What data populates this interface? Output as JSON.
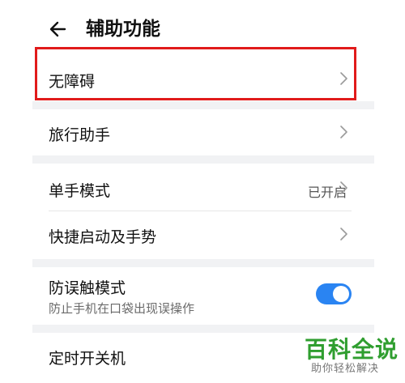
{
  "header": {
    "title": "辅助功能",
    "back_icon": "arrow-left-icon"
  },
  "rows": {
    "accessibility": {
      "label": "无障碍",
      "chevron": "chevron-right-icon"
    },
    "travel": {
      "label": "旅行助手",
      "chevron": "chevron-right-icon"
    },
    "one_hand": {
      "label": "单手模式",
      "value": "已开启",
      "chevron": "chevron-right-icon"
    },
    "shortcut": {
      "label": "快捷启动及手势",
      "chevron": "chevron-right-icon"
    },
    "anti_touch": {
      "label": "防误触模式",
      "subtitle": "防止手机在口袋出现误操作",
      "toggle_on": true
    },
    "timer_power": {
      "label": "定时开关机"
    }
  },
  "colors": {
    "accent": "#2a84f2",
    "highlight": "#e11b1b",
    "watermark": "#2f9e2f"
  },
  "watermark": {
    "main": "百科全说",
    "sub": "助你轻松解决"
  }
}
